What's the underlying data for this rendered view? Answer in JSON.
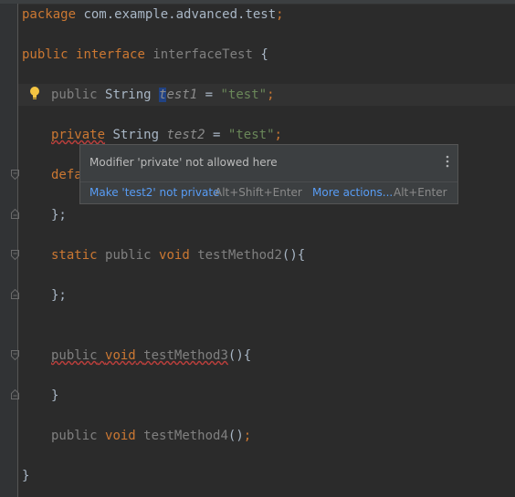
{
  "code": {
    "line1": {
      "kw": "package",
      "rest": " com.example.advanced.test",
      "semi": ";"
    },
    "line2": {
      "kw1": "public",
      "kw2": "interface",
      "name": "interfaceTest",
      "brace": "{"
    },
    "line3": {
      "kw": "public",
      "type": "String",
      "field_sel": "t",
      "field_rest": "est1",
      "eq": " = ",
      "str": "\"test\"",
      "semi": ";"
    },
    "line4": {
      "kw": "private",
      "type": "String",
      "field": "test2",
      "eq": " = ",
      "str": "\"test\"",
      "semi": ";"
    },
    "line5": {
      "kw": "defa"
    },
    "line6": {
      "text": "};"
    },
    "line7": {
      "kw1": "static",
      "kw2": "public",
      "kw3": "void",
      "name": "testMethod2",
      "rest": "(){"
    },
    "line8": {
      "text": "};"
    },
    "line9": {
      "kw1": "public",
      "kw2": "void",
      "name": "testMethod3",
      "rest": "(){"
    },
    "line10": {
      "text": "}"
    },
    "line11": {
      "kw1": "public",
      "kw2": "void",
      "name": "testMethod4",
      "rest": "()",
      "semi": ";"
    },
    "line12": {
      "text": "}"
    }
  },
  "popup": {
    "title": "Modifier 'private' not allowed here",
    "fix_label": "Make 'test2' not private",
    "fix_shortcut": "Alt+Shift+Enter",
    "more_label": "More actions...",
    "more_shortcut": "Alt+Enter"
  },
  "icons": {
    "bulb": "lightbulb-icon",
    "more": "more-vertical-icon",
    "fold": "fold-marker-icon"
  },
  "colors": {
    "background": "#2b2b2b",
    "keyword": "#cc7832",
    "string": "#6a8759",
    "field": "#9876aa",
    "link": "#589df6",
    "error": "#bc3f3c"
  }
}
